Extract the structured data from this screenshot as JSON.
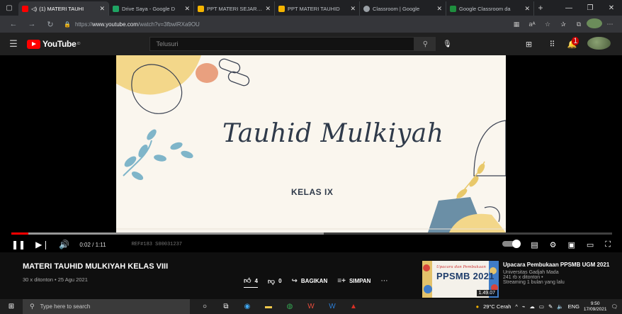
{
  "browser": {
    "tabs": [
      {
        "title": "(1) MATERI TAUHI",
        "icon": "youtube-icon",
        "color": "#ff0000",
        "active": true,
        "speaker": "◁)"
      },
      {
        "title": "Drive Saya - Google D",
        "icon": "drive-icon",
        "color": "#1fa463",
        "active": false
      },
      {
        "title": "PPT MATERI SEJARAH",
        "icon": "slides-icon",
        "color": "#f4b400",
        "active": false
      },
      {
        "title": "PPT MATERI TAUHID",
        "icon": "slides-icon",
        "color": "#f4b400",
        "active": false
      },
      {
        "title": "Classroom | Google",
        "icon": "classroom-icon",
        "color": "#9aa0a6",
        "active": false
      },
      {
        "title": "Google Classroom da",
        "icon": "classroom-icon",
        "color": "#1e8e3e",
        "active": false
      }
    ],
    "url_scheme": "https://",
    "url_host": "www.youtube.com",
    "url_path": "/watch?v=3fbwlRXa9OU"
  },
  "youtube": {
    "logo_text": "YouTube",
    "region": "ID",
    "search_placeholder": "Telusuri",
    "notification_count": "1"
  },
  "video": {
    "slide_title": "Tauhid Mulkiyah",
    "slide_subtitle": "KELAS IX",
    "time": "0:02 / 1:11",
    "played_fraction": 0.028,
    "loaded_fraction": 0.52,
    "watermark": "REF#183 S00031237",
    "title": "MATERI TAUHID MULKIYAH KELAS VIII",
    "meta": "30 x ditonton • 25 Agu 2021",
    "likes": "4",
    "dislikes": "0",
    "share_label": "BAGIKAN",
    "save_label": "SIMPAN"
  },
  "recommendation": {
    "title": "Upacara Pembukaan PPSMB UGM 2021",
    "channel": "Universitas Gadjah Mada",
    "views": "241 rb x ditonton •",
    "stream": "Streaming 1 bulan yang lalu",
    "duration": "1.49.07",
    "thumb_small": "Upacara dan Pembukaan",
    "thumb_big": "PPSMB 2021"
  },
  "taskbar": {
    "search_placeholder": "Type here to search",
    "weather": "29°C  Cerah",
    "language": "ENG",
    "time": "9:50",
    "date": "17/09/2021"
  }
}
